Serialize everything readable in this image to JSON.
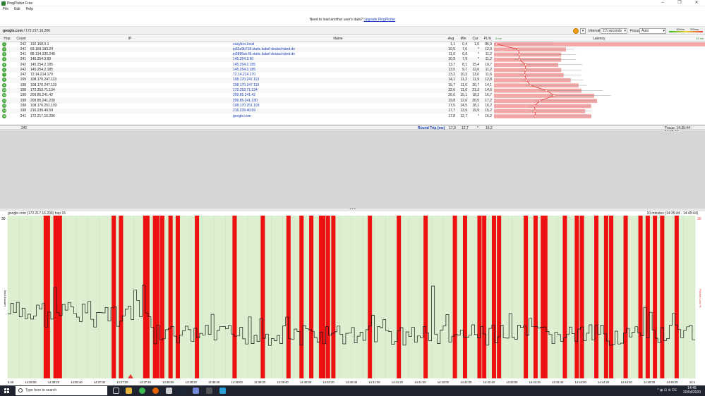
{
  "window": {
    "title": "PingPlotter Free"
  },
  "menu": [
    "File",
    "Edit",
    "Help"
  ],
  "banner": {
    "text": "Need to load another user's data?",
    "link": "Upgrade PingPlotter"
  },
  "target": {
    "host": "google.com",
    "ip": " / 172.217.16.206"
  },
  "controls": {
    "interval_label": "Interval",
    "interval_value": "2.5 seconds",
    "focus_label": "Focus",
    "focus_value": "Auto",
    "scale_low": "100ms",
    "scale_high": "200ms"
  },
  "columns": {
    "hop": "Hop",
    "count": "Count",
    "ip": "IP",
    "name": "Name",
    "avg": "Avg",
    "min": "Min",
    "cur": "Cur",
    "pl": "PL%",
    "latency": "Latency",
    "ms0": "0 ms",
    "ms91": "91 ms"
  },
  "hops": [
    {
      "hop": "1",
      "count": "242",
      "ip": "192.168.0.1",
      "name": "easybox.local",
      "avg": "1,1",
      "min": "0,4",
      "cur": "1,0",
      "pl": "86,0",
      "avgv": 1.1,
      "plv": 86.0
    },
    {
      "hop": "2",
      "count": "241",
      "ip": "83.169.183.24",
      "name": "ip53a9b718.static.kabel-deutschland.de",
      "avg": "10,5",
      "min": "7,6",
      "cur": "*",
      "pl": "12,0",
      "avgv": 10.5,
      "plv": 12.0
    },
    {
      "hop": "3",
      "count": "241",
      "ip": "88.134.235.248",
      "name": "ip5886eb f8.static.kabel-deutschland.de",
      "avg": "11,0",
      "min": "6,9",
      "cur": "*",
      "pl": "11,2",
      "avgv": 11.0,
      "plv": 11.2
    },
    {
      "hop": "4",
      "count": "241",
      "ip": "145.254.3.60",
      "name": "145.254.3.60",
      "avg": "10,9",
      "min": "7,9",
      "cur": "*",
      "pl": "11,2",
      "avgv": 10.9,
      "plv": 11.2
    },
    {
      "hop": "5",
      "count": "242",
      "ip": "145.254.2.185",
      "name": "145.254.2.185",
      "avg": "13,7",
      "min": "8,1",
      "cur": "15,4",
      "pl": "10,7",
      "avgv": 13.7,
      "plv": 10.7
    },
    {
      "hop": "6",
      "count": "242",
      "ip": "145.254.2.185",
      "name": "145.254.2.185",
      "avg": "13,5",
      "min": "9,7",
      "cur": "12,6",
      "pl": "11,2",
      "avgv": 13.5,
      "plv": 11.2
    },
    {
      "hop": "7",
      "count": "242",
      "ip": "72.14.214.170",
      "name": "72.14.214.170",
      "avg": "13,2",
      "min": "10,3",
      "cur": "13,0",
      "pl": "11,6",
      "avgv": 13.2,
      "plv": 11.6
    },
    {
      "hop": "8",
      "count": "199",
      "ip": "108.170.247.113",
      "name": "108.170.247.113",
      "avg": "14,1",
      "min": "11,2",
      "cur": "11,9",
      "pl": "12,8",
      "avgv": 14.1,
      "plv": 12.8
    },
    {
      "hop": "9",
      "count": "198",
      "ip": "108.170.247.119",
      "name": "108.170.247.119",
      "avg": "15,7",
      "min": "11,0",
      "cur": "20,7",
      "pl": "14,1",
      "avgv": 15.7,
      "plv": 14.1
    },
    {
      "hop": "10",
      "count": "198",
      "ip": "172.253.71.134",
      "name": "172.253.71.134",
      "avg": "22,6",
      "min": "11,0",
      "cur": "21,3",
      "pl": "14,6",
      "avgv": 22.6,
      "plv": 14.6
    },
    {
      "hop": "11",
      "count": "198",
      "ip": "209.85.241.42",
      "name": "209.85.241.42",
      "avg": "26,0",
      "min": "15,1",
      "cur": "18,3",
      "pl": "16,7",
      "avgv": 26.0,
      "plv": 16.7
    },
    {
      "hop": "12",
      "count": "198",
      "ip": "209.85.241.230",
      "name": "209.85.241.230",
      "avg": "19,8",
      "min": "12,6",
      "cur": "20,5",
      "pl": "17,2",
      "avgv": 19.8,
      "plv": 17.2
    },
    {
      "hop": "13",
      "count": "198",
      "ip": "108.170.251.193",
      "name": "108.170.251.193",
      "avg": "17,5",
      "min": "14,5",
      "cur": "18,1",
      "pl": "16,2",
      "avgv": 17.5,
      "plv": 16.2
    },
    {
      "hop": "14",
      "count": "198",
      "ip": "216.239.40.59",
      "name": "216.239.40.59",
      "avg": "17,7",
      "min": "13,9",
      "cur": "19,9",
      "pl": "15,2",
      "avgv": 17.7,
      "plv": 15.2
    },
    {
      "hop": "15",
      "count": "241",
      "ip": "172.217.16.206",
      "name": "google.com",
      "avg": "17,8",
      "min": "12,7",
      "cur": "*",
      "pl": "16,2",
      "avgv": 17.8,
      "plv": 16.2
    }
  ],
  "summary": {
    "count": "241",
    "label": "Round Trip (ms)",
    "avg": "17,9",
    "min": "12,7",
    "cur": "*",
    "pl": "16,2",
    "focus": "Focus: 14:35:44 - 14:45:44"
  },
  "timeline": {
    "title": "google.com (172.217.16.206) hop 15",
    "range": "10 minutes (14:35:44 - 14:45:44)",
    "ylabel": "Latency (ms)",
    "y2label": "Packet Loss %",
    "y_top": "30",
    "y2_top": "30",
    "x_labels": [
      "5:40",
      "14:36:00",
      "14:36:20",
      "14:36:40",
      "14:37:00",
      "14:37:20",
      "14:37:40",
      "14:38:00",
      "14:38:20",
      "14:38:40",
      "14:39:00",
      "14:39:20",
      "14:39:40",
      "14:40:00",
      "14:40:20",
      "14:40:40",
      "14:41:00",
      "14:41:20",
      "14:41:40",
      "14:42:00",
      "14:42:20",
      "14:42:40",
      "14:43:00",
      "14:43:20",
      "14:43:40",
      "14:44:00",
      "14:44:20",
      "14:44:40",
      "14:45:00",
      "14:45:20",
      "14:4"
    ],
    "loss_marks": [
      20.5,
      21.1,
      23.2,
      23.7,
      24.4,
      39.3,
      41.3,
      48.0,
      48.6,
      50.7,
      51.4,
      52.7,
      55.0,
      57.0,
      62.3,
      72.7,
      80.5,
      87.6,
      91.2,
      93.9,
      96.6,
      97.2,
      98.5,
      100.0,
      110.1,
      118.1,
      125.5,
      133.6,
      136.4,
      140.4,
      141.7,
      144.4,
      145.8,
      153.2,
      155.9,
      157.9,
      158.6,
      164.0,
      167.3,
      168.7,
      172.7,
      175.4,
      176.8,
      180.8,
      184.9,
      186.9,
      188.9,
      190.9,
      194.9
    ]
  },
  "taskbar": {
    "search": "Type here to search",
    "time": "14:45",
    "date": "20/04/2020",
    "tray": "^ ◉ ⊟ ⊕ DE"
  },
  "colors": {
    "loss": "#ee1111",
    "good": "#dcefd0",
    "bar": "#f4a7a7"
  }
}
